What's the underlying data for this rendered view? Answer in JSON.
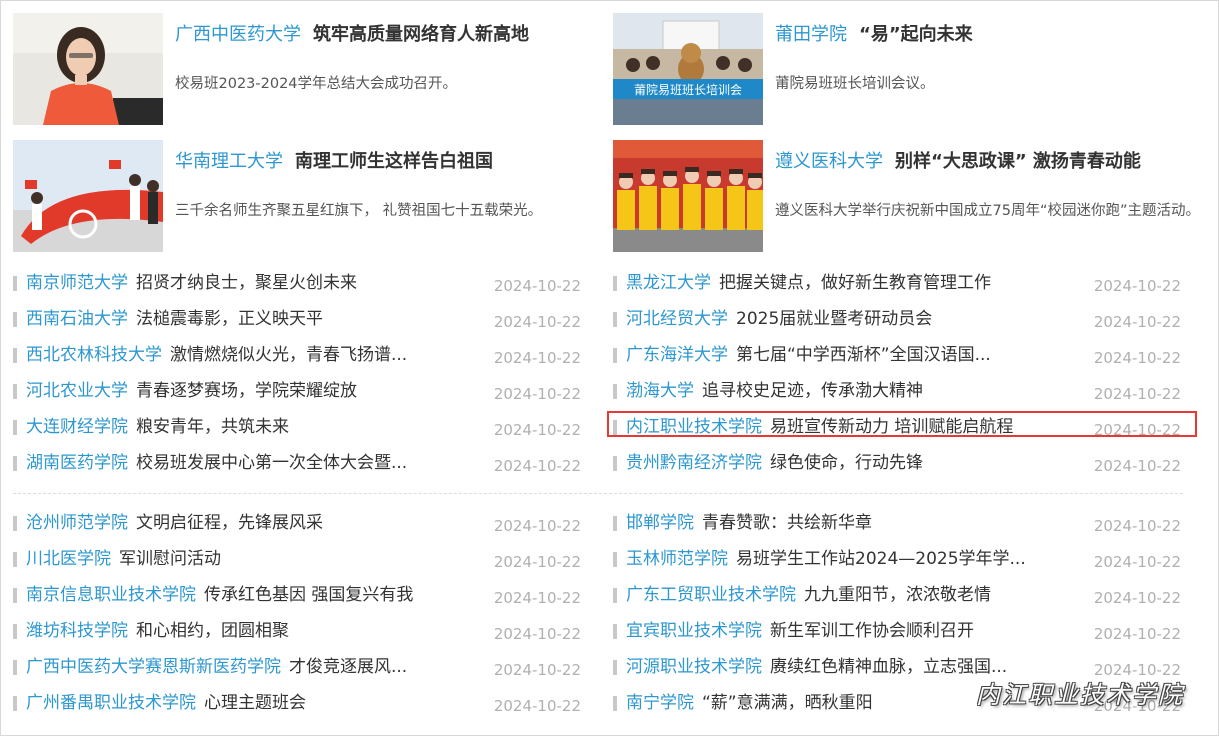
{
  "features": [
    {
      "school": "广西中医药大学",
      "headline": "筑牢高质量网络育人新高地",
      "summary": "校易班2023-2024学年总结大会成功召开。"
    },
    {
      "school": "莆田学院",
      "headline": "“易”起向未来",
      "summary": "莆院易班班长培训会议。",
      "photo_text": "莆院易班班长培训会"
    },
    {
      "school": "华南理工大学",
      "headline": "南理工师生这样告白祖国",
      "summary": "三千余名师生齐聚五星红旗下， 礼赞祖国七十五载荣光。"
    },
    {
      "school": "遵义医科大学",
      "headline": "别样“大思政课” 激扬青春动能",
      "summary": "遵义医科大学举行庆祝新中国成立75周年“校园迷你跑”主题活动。"
    }
  ],
  "list_left_top": [
    {
      "school": "南京师范大学",
      "title": "招贤才纳良士，聚星火创未来",
      "date": "2024-10-22"
    },
    {
      "school": "西南石油大学",
      "title": "法槌震毒影，正义映天平",
      "date": "2024-10-22"
    },
    {
      "school": "西北农林科技大学",
      "title": "激情燃烧似火光，青春飞扬谱...",
      "date": "2024-10-22"
    },
    {
      "school": "河北农业大学",
      "title": "青春逐梦赛场，学院荣耀绽放",
      "date": "2024-10-22"
    },
    {
      "school": "大连财经学院",
      "title": "粮安青年，共筑未来",
      "date": "2024-10-22"
    },
    {
      "school": "湖南医药学院",
      "title": "校易班发展中心第一次全体大会暨...",
      "date": "2024-10-22"
    }
  ],
  "list_right_top": [
    {
      "school": "黑龙江大学",
      "title": "把握关键点，做好新生教育管理工作",
      "date": "2024-10-22"
    },
    {
      "school": "河北经贸大学",
      "title": "2025届就业暨考研动员会",
      "date": "2024-10-22"
    },
    {
      "school": "广东海洋大学",
      "title": "第七届“中学西渐杯”全国汉语国...",
      "date": "2024-10-22"
    },
    {
      "school": "渤海大学",
      "title": "追寻校史足迹，传承渤大精神",
      "date": "2024-10-22"
    },
    {
      "school": "内江职业技术学院",
      "title": "易班宣传新动力 培训赋能启航程",
      "date": "2024-10-22"
    },
    {
      "school": "贵州黔南经济学院",
      "title": "绿色使命，行动先锋",
      "date": "2024-10-22"
    }
  ],
  "list_left_bottom": [
    {
      "school": "沧州师范学院",
      "title": "文明启征程，先锋展风采",
      "date": "2024-10-22"
    },
    {
      "school": "川北医学院",
      "title": "军训慰问活动",
      "date": "2024-10-22"
    },
    {
      "school": "南京信息职业技术学院",
      "title": "传承红色基因 强国复兴有我",
      "date": "2024-10-22"
    },
    {
      "school": "潍坊科技学院",
      "title": "和心相约，团圆相聚",
      "date": "2024-10-22"
    },
    {
      "school": "广西中医药大学赛恩斯新医药学院",
      "title": "才俊竞逐展风...",
      "date": "2024-10-22"
    },
    {
      "school": "广州番禺职业技术学院",
      "title": "心理主题班会",
      "date": "2024-10-22"
    }
  ],
  "list_right_bottom": [
    {
      "school": "邯郸学院",
      "title": "青春赞歌：共绘新华章",
      "date": "2024-10-22"
    },
    {
      "school": "玉林师范学院",
      "title": "易班学生工作站2024—2025学年学...",
      "date": "2024-10-22"
    },
    {
      "school": "广东工贸职业技术学院",
      "title": "九九重阳节，浓浓敬老情",
      "date": "2024-10-22"
    },
    {
      "school": "宜宾职业技术学院",
      "title": "新生军训工作协会顺利召开",
      "date": "2024-10-22"
    },
    {
      "school": "河源职业技术学院",
      "title": "赓续红色精神血脉，立志强国...",
      "date": "2024-10-22"
    },
    {
      "school": "南宁学院",
      "title": "“薪”意满满，晒秋重阳",
      "date": "2024-10-22"
    }
  ],
  "watermark": "内江职业技术学院",
  "colors": {
    "link": "#2d97d0",
    "title": "#333333",
    "date": "#b0b0b0",
    "highlight": "#e53935"
  }
}
